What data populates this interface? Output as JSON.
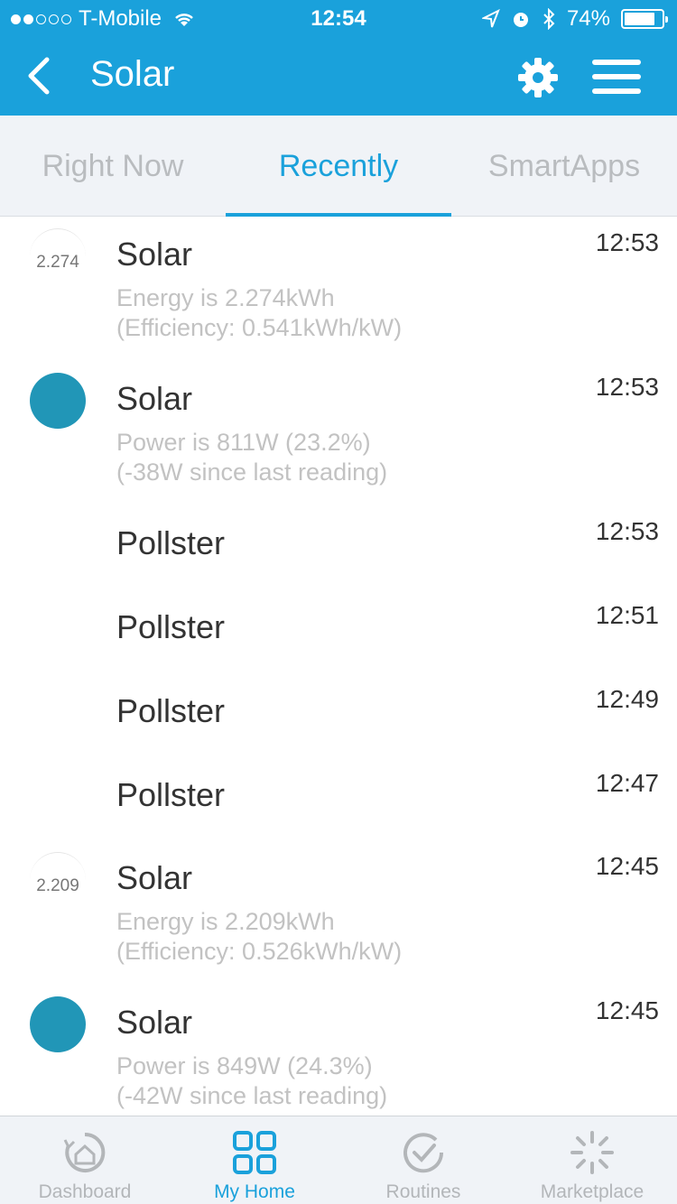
{
  "status_bar": {
    "carrier": "T-Mobile",
    "time": "12:54",
    "battery": "74%"
  },
  "nav": {
    "title": "Solar"
  },
  "tabs": [
    {
      "label": "Right Now"
    },
    {
      "label": "Recently"
    },
    {
      "label": "SmartApps"
    }
  ],
  "activity": [
    {
      "badge": "2.274",
      "title": "Solar",
      "line1": "Energy is 2.274kWh",
      "line2": "(Efficiency: 0.541kWh/kW)",
      "time": "12:53"
    },
    {
      "title": "Solar",
      "line1": "Power is 811W (23.2%)",
      "line2": "(-38W since last reading)",
      "time": "12:53"
    },
    {
      "title": "Pollster",
      "time": "12:53"
    },
    {
      "title": "Pollster",
      "time": "12:51"
    },
    {
      "title": "Pollster",
      "time": "12:49"
    },
    {
      "title": "Pollster",
      "time": "12:47"
    },
    {
      "badge": "2.209",
      "title": "Solar",
      "line1": "Energy is 2.209kWh",
      "line2": "(Efficiency: 0.526kWh/kW)",
      "time": "12:45"
    },
    {
      "title": "Solar",
      "line1": "Power is 849W (24.3%)",
      "line2": "(-42W since last reading)",
      "time": "12:45"
    }
  ],
  "bottom_tabs": [
    {
      "label": "Dashboard"
    },
    {
      "label": "My Home"
    },
    {
      "label": "Routines"
    },
    {
      "label": "Marketplace"
    }
  ],
  "colors": {
    "brand": "#1aa1db",
    "power_dot": "#2196b7"
  }
}
